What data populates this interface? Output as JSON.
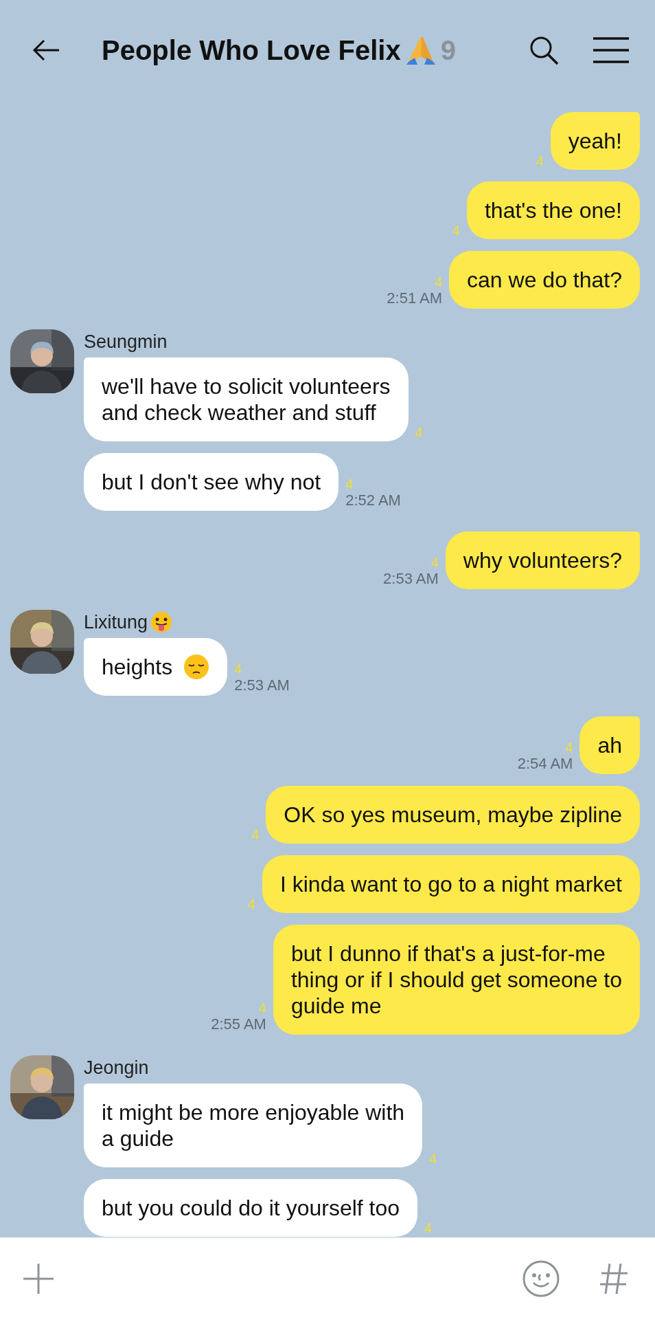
{
  "header": {
    "title": "People Who Love Felix",
    "title_emoji": {
      "kind": "pray"
    },
    "member_count": "9"
  },
  "groups": [
    {
      "kind": "me",
      "messages": [
        {
          "text": "yeah!",
          "unread": "4"
        },
        {
          "text": "that's the one!",
          "unread": "4"
        },
        {
          "text": "can we do that?",
          "unread": "4",
          "time": "2:51 AM"
        }
      ]
    },
    {
      "kind": "other",
      "sender": "Seungmin",
      "messages": [
        {
          "text": "we'll have to solicit volunteers\nand check weather and stuff",
          "unread": "4"
        },
        {
          "text": "but I don't see why not",
          "unread": "4",
          "time": "2:52 AM"
        }
      ]
    },
    {
      "kind": "me",
      "messages": [
        {
          "text": "why volunteers?",
          "unread": "4",
          "time": "2:53 AM"
        }
      ]
    },
    {
      "kind": "other",
      "sender": "Lixitung",
      "sender_emoji": {
        "kind": "tongue"
      },
      "messages": [
        {
          "text": "heights",
          "emoji": {
            "kind": "pensive"
          },
          "unread": "4",
          "time": "2:53 AM"
        }
      ]
    },
    {
      "kind": "me",
      "messages": [
        {
          "text": "ah",
          "unread": "4",
          "time": "2:54 AM"
        },
        {
          "text": "OK so yes museum, maybe zipline",
          "unread": "4"
        },
        {
          "text": "I kinda want to go to a night market",
          "unread": "4"
        },
        {
          "text": "but I dunno if that's a just-for-me\nthing or if I should get someone to\nguide me",
          "unread": "4",
          "time": "2:55 AM"
        }
      ]
    },
    {
      "kind": "other",
      "sender": "Jeongin",
      "messages": [
        {
          "text": "it might be more enjoyable with\na guide",
          "unread": "4"
        },
        {
          "text": "but you could do it yourself too",
          "unread": "4"
        }
      ]
    }
  ]
}
